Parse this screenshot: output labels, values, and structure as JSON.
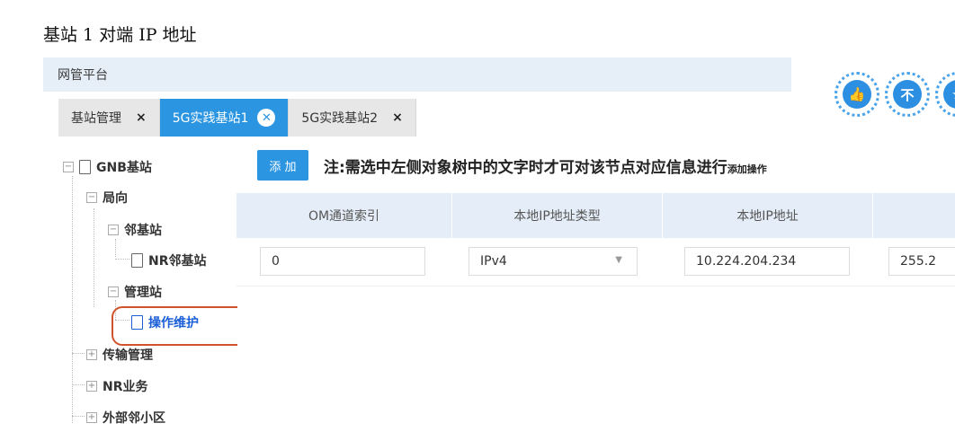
{
  "caption": "基站 1 对端 IP 地址",
  "app": {
    "title": "网管平台"
  },
  "tabs": [
    {
      "label": "基站管理",
      "close": "×"
    },
    {
      "label": "5G实践基站1",
      "close": "✕"
    },
    {
      "label": "5G实践基站2",
      "close": "×"
    }
  ],
  "tree": {
    "root": "GNB基站",
    "n1": "局向",
    "n2": "邻基站",
    "n3": "NR邻基站",
    "n4": "管理站",
    "n5": "操作维护",
    "n6": "传输管理",
    "n7": "NR业务",
    "n8": "外部邻小区",
    "collapse_glyph": "−",
    "expand_glyph": "+"
  },
  "toolbar": {
    "add_label": "添 加",
    "note": "注:需选中左侧对象树中的文字时才可对该节点对应信息进行",
    "note_tail": "添加操作"
  },
  "table": {
    "headers": [
      "OM通道索引",
      "本地IP地址类型",
      "本地IP地址"
    ],
    "row": {
      "om_index": "0",
      "ip_type": "IPv4",
      "ip_address": "10.224.204.234",
      "mask_partial": "255.2"
    },
    "caret": "▼"
  },
  "icons": [
    {
      "name": "thumbs-up-icon",
      "glyph": "👍"
    },
    {
      "name": "dislike-icon",
      "glyph": "不"
    },
    {
      "name": "favorite-icon",
      "glyph": "★"
    }
  ],
  "colors": {
    "accent": "#2b95e1",
    "header_bg": "#e5eef8",
    "selected": "#1a5fd6",
    "annotation": "#d0532b"
  }
}
